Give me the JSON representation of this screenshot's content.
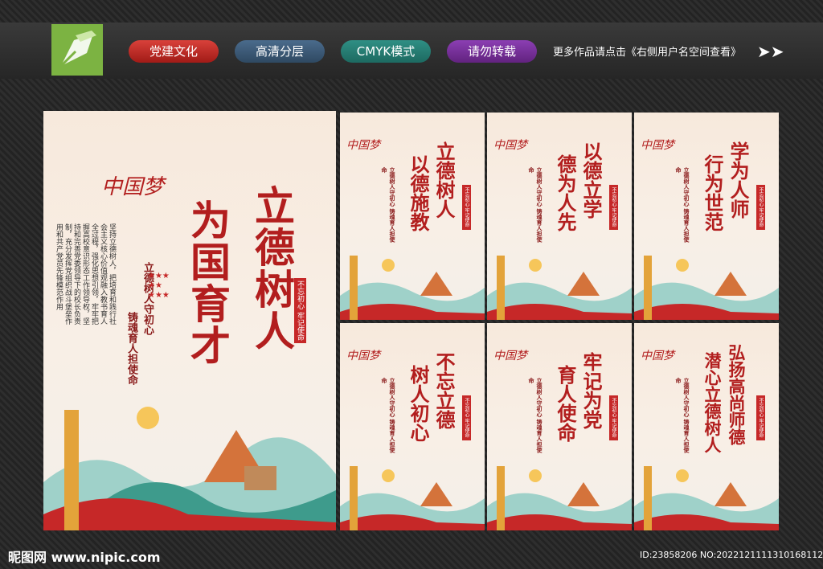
{
  "header": {
    "tags": [
      "党建文化",
      "高清分层",
      "CMYK模式",
      "请勿转载"
    ],
    "notice": "更多作品请点击《右侧用户名空间查看》"
  },
  "main_poster": {
    "title_col1": "立德树人",
    "title_col2": "为国育才",
    "motto_a": "立德树人守初心",
    "motto_b": "铸魂育人担使命",
    "red_box": "不忘初心 牢记使命",
    "body_text": "坚持立德树人，把培育和践行社会主义核心价值观融入教书育人全过程，强化思想引领，牢牢把握高校意识形态工作领导权，坚持和完善党委领导下的校长负责制，充分发挥党组织战斗堡垒作用和共产党员先锋模范作用"
  },
  "small_posters": [
    {
      "col1": "立德树人",
      "col2": "以德施教"
    },
    {
      "col1": "以德立学",
      "col2": "德为人先"
    },
    {
      "col1": "学为人师",
      "col2": "行为世范"
    },
    {
      "col1": "不忘立德",
      "col2": "树人初心"
    },
    {
      "col1": "牢记为党",
      "col2": "育人使命"
    },
    {
      "col1": "弘扬高尚师德",
      "col2": "潜心立德树人"
    }
  ],
  "small_motto": "立德树人守初心  铸魂育人担使命",
  "small_red_box": "不忘初心 牢记使命",
  "footer": {
    "site": "昵图网 www.nipic.com",
    "id": "ID:23858206 NO:20221211113101681127"
  },
  "colors": {
    "accent_red": "#b21e1e",
    "logo_green": "#7cb342"
  }
}
